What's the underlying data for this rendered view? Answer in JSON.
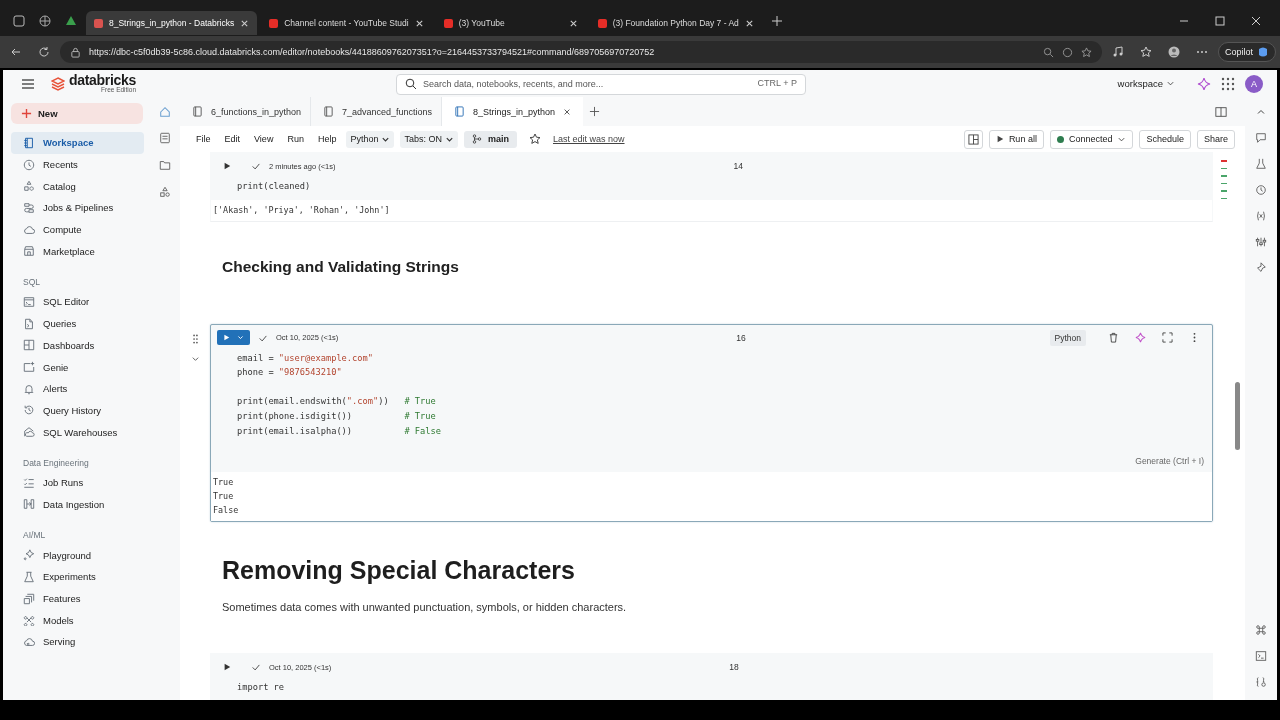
{
  "browser": {
    "tabs": [
      {
        "title": "8_Strings_in_python - Databricks",
        "selected": true,
        "color": "#d9534f"
      },
      {
        "title": "Channel content - YouTube Studi",
        "selected": false,
        "color": "#e52d27"
      },
      {
        "title": "(3) YouTube",
        "selected": false,
        "color": "#e52d27"
      },
      {
        "title": "(3) Foundation Python Day 7 - Ad",
        "selected": false,
        "color": "#e52d27"
      }
    ],
    "url": "https://dbc-c5f0db39-5c86.cloud.databricks.com/editor/notebooks/4418860976207351?o=2164453733794521#command/6897056970720752",
    "profile_button": "Copilot"
  },
  "header": {
    "brand": "databricks",
    "edition": "Free Edition",
    "search": {
      "placeholder": "Search data, notebooks, recents, and more...",
      "shortcut": "CTRL + P"
    },
    "workspace": "workspace",
    "avatar": "A"
  },
  "sidebar": {
    "new_button": "New",
    "sections": [
      {
        "items": [
          {
            "label": "Workspace",
            "selected": true
          },
          {
            "label": "Recents",
            "selected": false
          },
          {
            "label": "Catalog",
            "selected": false
          },
          {
            "label": "Jobs & Pipelines",
            "selected": false
          },
          {
            "label": "Compute",
            "selected": false
          },
          {
            "label": "Marketplace",
            "selected": false
          }
        ]
      },
      {
        "heading": "SQL",
        "items": [
          {
            "label": "SQL Editor",
            "selected": false
          },
          {
            "label": "Queries",
            "selected": false
          },
          {
            "label": "Dashboards",
            "selected": false
          },
          {
            "label": "Genie",
            "selected": false
          },
          {
            "label": "Alerts",
            "selected": false
          },
          {
            "label": "Query History",
            "selected": false
          },
          {
            "label": "SQL Warehouses",
            "selected": false
          }
        ]
      },
      {
        "heading": "Data Engineering",
        "items": [
          {
            "label": "Job Runs",
            "selected": false
          },
          {
            "label": "Data Ingestion",
            "selected": false
          }
        ]
      },
      {
        "heading": "AI/ML",
        "items": [
          {
            "label": "Playground",
            "selected": false
          },
          {
            "label": "Experiments",
            "selected": false
          },
          {
            "label": "Features",
            "selected": false
          },
          {
            "label": "Models",
            "selected": false
          },
          {
            "label": "Serving",
            "selected": false
          }
        ]
      }
    ]
  },
  "notebook_tabs": [
    {
      "label": "6_functions_in_python",
      "selected": false
    },
    {
      "label": "7_advanced_functions",
      "selected": false
    },
    {
      "label": "8_Strings_in_python",
      "selected": true
    }
  ],
  "menu": {
    "items": [
      "File",
      "Edit",
      "View",
      "Run",
      "Help"
    ],
    "language": "Python",
    "tabs_setting": "Tabs: ON",
    "branch": "main",
    "last_edit": "Last edit was now",
    "run_all": "Run all",
    "connection": {
      "label": "Connected",
      "color": "#2e7d4f"
    },
    "schedule": "Schedule",
    "share": "Share"
  },
  "cells": [
    {
      "kind": "code",
      "active": false,
      "status": "2 minutes ago (<1s)",
      "number": "14",
      "blocks": [
        [
          [
            {
              "kind": "plain",
              "text": "print(cleaned)"
            }
          ]
        ]
      ],
      "output": [
        "['Akash', 'Priya', 'Rohan', 'John']"
      ]
    },
    {
      "kind": "heading",
      "text": "Checking and Validating Strings"
    },
    {
      "kind": "code",
      "active": true,
      "status": "Oct 10, 2025 (<1s)",
      "number": "16",
      "language": "Python",
      "hint": "Generate (Ctrl + I)",
      "blocks": [
        [
          [
            {
              "kind": "plain",
              "text": "email = "
            },
            {
              "kind": "string",
              "text": "\"user@example.com\""
            }
          ],
          [
            {
              "kind": "plain",
              "text": "phone = "
            },
            {
              "kind": "string",
              "text": "\"9876543210\""
            }
          ]
        ],
        [
          [
            {
              "kind": "plain",
              "text": "print(email.endswith("
            },
            {
              "kind": "string",
              "text": "\".com\""
            },
            {
              "kind": "plain",
              "text": "))   "
            },
            {
              "kind": "comment",
              "text": "# True"
            }
          ],
          [
            {
              "kind": "plain",
              "text": "print(phone.isdigit())          "
            },
            {
              "kind": "comment",
              "text": "# True"
            }
          ],
          [
            {
              "kind": "plain",
              "text": "print(email.isalpha())          "
            },
            {
              "kind": "comment",
              "text": "# False"
            }
          ]
        ]
      ],
      "output": [
        "True",
        "True",
        "False"
      ]
    },
    {
      "kind": "title",
      "text": "Removing Special Characters"
    },
    {
      "kind": "paragraph",
      "text": "Sometimes data comes with unwanted punctuation, symbols, or hidden characters."
    },
    {
      "kind": "code",
      "active": false,
      "status": "Oct 10, 2025 (<1s)",
      "number": "18",
      "blocks": [
        [
          [
            {
              "kind": "plain",
              "text": "import re"
            }
          ]
        ]
      ]
    }
  ]
}
